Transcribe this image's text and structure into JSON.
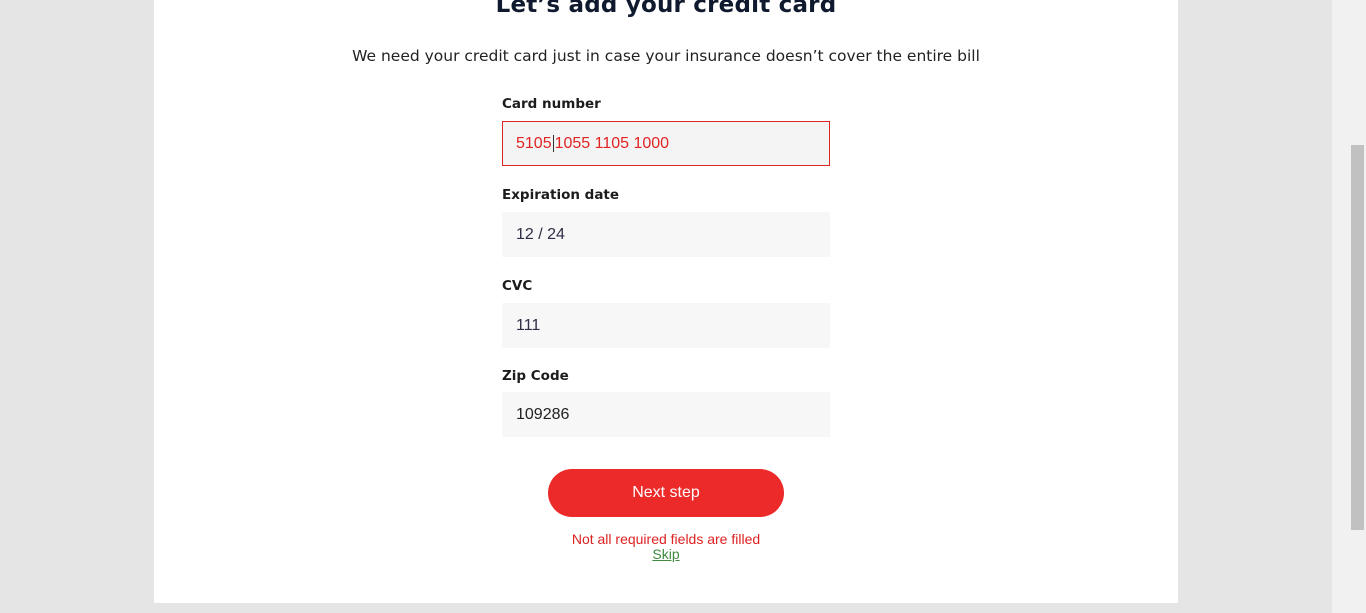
{
  "header": {
    "title": "Let’s add your credit card",
    "subtitle": "We need your credit card just in case your insurance doesn’t cover the entire bill"
  },
  "form": {
    "card_number": {
      "label": "Card number",
      "value_before_caret": "5105",
      "value_after_caret": "1055 1105 1000"
    },
    "expiration": {
      "label": "Expiration date",
      "value": "12 / 24"
    },
    "cvc": {
      "label": "CVC",
      "value": "111"
    },
    "zip": {
      "label": "Zip Code",
      "value": "109286"
    }
  },
  "actions": {
    "next_label": "Next step",
    "error_message": "Not all required fields are filled",
    "skip_label": "Skip"
  },
  "colors": {
    "accent": "#ec2a2a",
    "error": "#e02424",
    "skip": "#3f8a3f"
  }
}
